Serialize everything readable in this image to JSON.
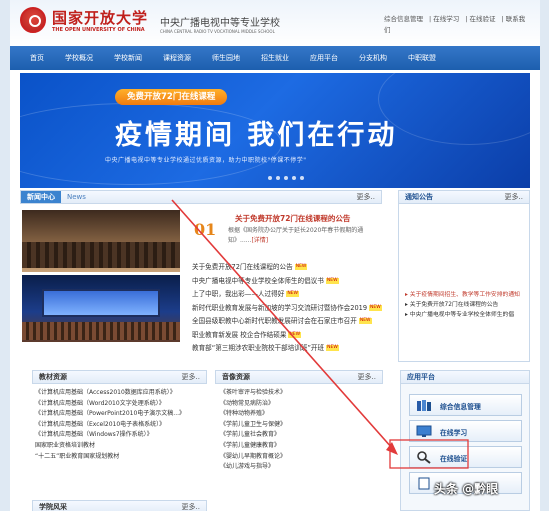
{
  "header": {
    "brand_cn": "国家开放大学",
    "brand_en": "THE OPEN UNIVERSITY OF CHINA",
    "school_cn": "中央广播电视中等专业学校",
    "school_en": "CHINA CENTRAL RADIO TV VOCATIONAL MIDDLE SCHOOL",
    "top_links": [
      "综合信息管理",
      "在线学习",
      "在线验证",
      "联系我们"
    ]
  },
  "nav": [
    "首页",
    "学校概况",
    "学校新闻",
    "课程资源",
    "师生园地",
    "招生就业",
    "应用平台",
    "分支机构",
    "中职联盟"
  ],
  "banner": {
    "pill": "免费开放72门在线课程",
    "title": "疫情期间 我们在行动",
    "subtitle": "中央广播电视中等专业学校通过优质资源，助力中职院校\"停课不停学\""
  },
  "news": {
    "title": "新闻中心",
    "title_en": "News",
    "more": "更多..",
    "featured_date": "01",
    "featured_title": "关于免费开放72门在线课程的公告",
    "featured_desc": "根据《国务院办公厅关于延长2020年春节假期的通知》......",
    "featured_link": "[详情]",
    "new_tag": "NEW",
    "items": [
      "关于免费开放72门在线课程的公告",
      "中央广播电视中等专业学校全体师生的倡议书",
      "上了中职，我出彩——人过得好",
      "新时代职业教育发展与新加坡的学习交流研讨暨协作会2019",
      "全国县级职教中心新时代职教发展研讨会在石家庄市召开",
      "职业教育新发展 校企合作结硕果",
      "教育部“第三期涉农职业院校干部培训班”开班"
    ]
  },
  "notice": {
    "title": "通知公告",
    "more": "更多..",
    "items": [
      {
        "text": "关于疫情期间招生、教学等工作安排的通知",
        "red": true
      },
      {
        "text": "关于免费开放72门在线课程的公告",
        "red": false
      },
      {
        "text": "中央广播电视中等专业学校全体师生的倡",
        "red": false
      }
    ]
  },
  "resources": {
    "title": "教材资源",
    "more": "更多..",
    "items": [
      "《计算机应用基础（Access2010数据库应用系统）》",
      "《计算机应用基础（Word2010文字处理系统）》",
      "《计算机应用基础（PowerPoint2010电子演示文稿...》",
      "《计算机应用基础（Excel2010电子表格系统）》",
      "《计算机应用基础（Windows7操作系统）》",
      "国家职业资格培训教材",
      "“十二五”职业教育国家规划教材"
    ]
  },
  "av": {
    "title": "音像资源",
    "more": "更多..",
    "items": [
      "《茶叶审评与检验技术》",
      "《动物常见病防治》",
      "《特种动物养殖》",
      "《学前儿童卫生与保健》",
      "《学前儿童社会教育》",
      "《学前儿童健康教育》",
      "《婴幼儿早期教育概论》",
      "《幼儿游戏与指导》"
    ]
  },
  "platform": {
    "title": "应用平台",
    "items": [
      "综合信息管理",
      "在线学习",
      "在线验证"
    ]
  },
  "learning": {
    "title": "学院风采",
    "more": "更多.."
  },
  "watermark": "头条 @黔眼",
  "colors": {
    "nav": "#1d5fae",
    "brand": "#c0201c",
    "banner": "#0a52c8",
    "annotation": "#e23a3a"
  }
}
